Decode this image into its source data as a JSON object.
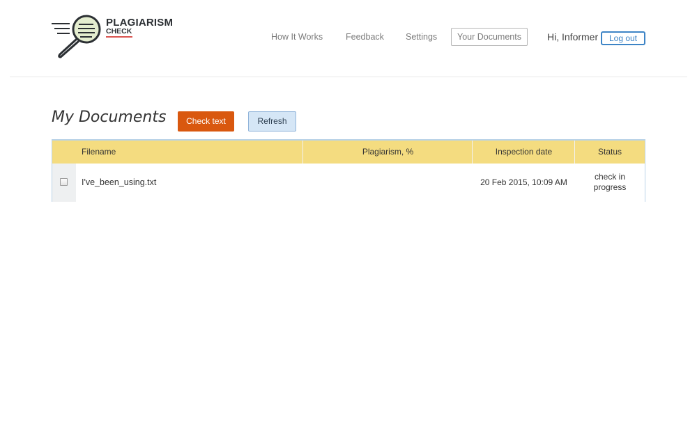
{
  "brand": {
    "name": "PLAGIARISM",
    "sub": "CHECK",
    "accent": "#d9534f",
    "icon": "magnifier-document-icon"
  },
  "nav": {
    "items": [
      {
        "label": "How It Works"
      },
      {
        "label": "Feedback"
      },
      {
        "label": "Settings"
      }
    ],
    "active": "Your Documents",
    "greeting": "Hi, Informer",
    "logout": "Log out"
  },
  "main": {
    "title": "My Documents",
    "check_button": "Check text",
    "refresh_button": "Refresh"
  },
  "table": {
    "columns": [
      "Filename",
      "Plagiarism, %",
      "Inspection date",
      "Status"
    ],
    "rows": [
      {
        "filename": "I've_been_using.txt",
        "plagiarism": "",
        "date": "20 Feb 2015, 10:09 AM",
        "status_line1": "check in",
        "status_line2": "progress"
      }
    ]
  },
  "colors": {
    "header_bg": "#f4dc80",
    "primary_button": "#d9580f",
    "secondary_button": "#d5e6f6",
    "link_blue": "#3d84c6"
  }
}
